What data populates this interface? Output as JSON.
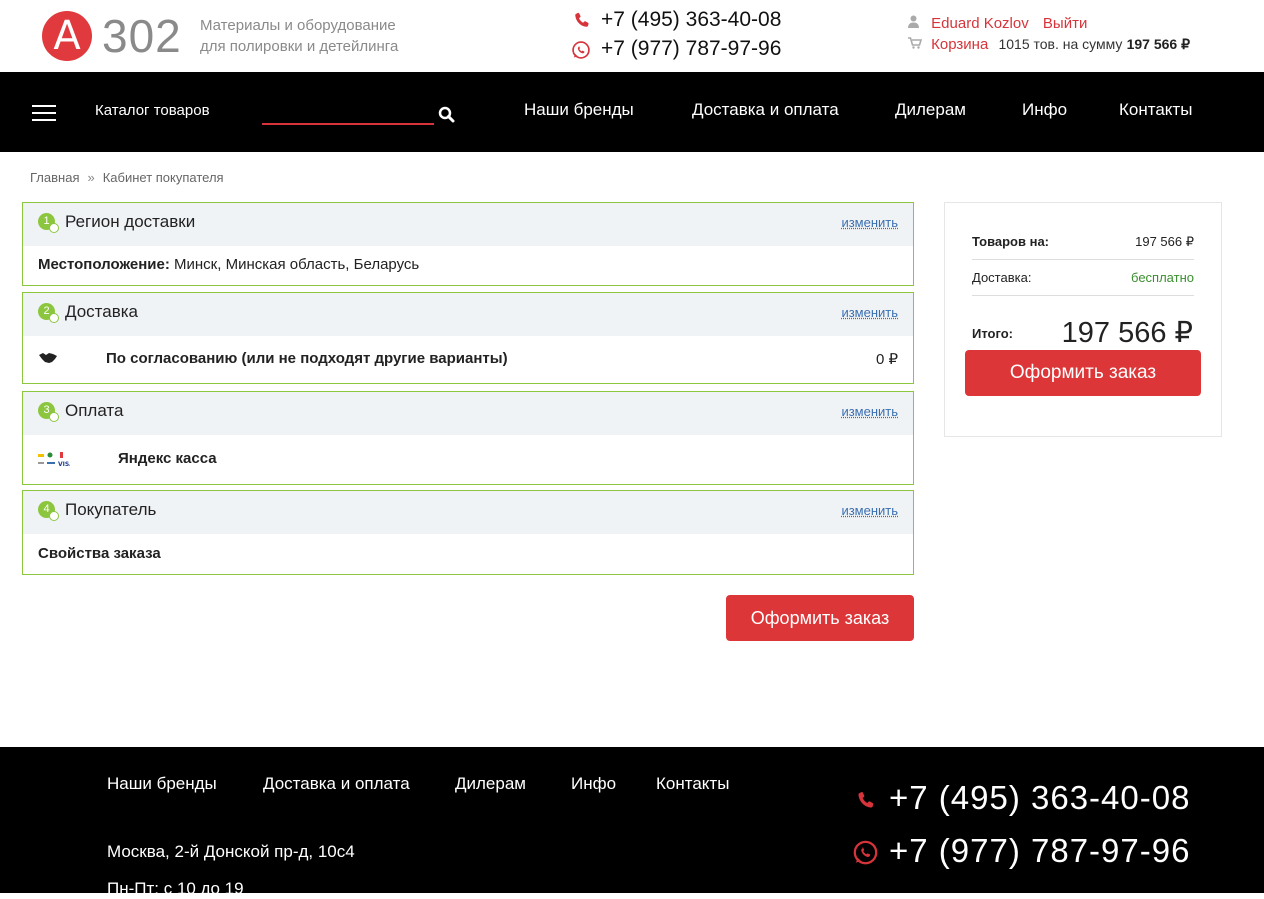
{
  "header": {
    "logo_letter": "A",
    "logo_number": "302",
    "tagline_1": "Материалы и оборудование",
    "tagline_2": "для полировки и детейлинга",
    "phone_1": "+7 (495) 363-40-08",
    "phone_2": "+7 (977) 787-97-96",
    "user_name": "Eduard Kozlov",
    "logout": "Выйти",
    "cart_label": "Корзина",
    "cart_summary": "1015 тов. на сумму",
    "cart_total": "197 566 ₽"
  },
  "nav": {
    "catalog": "Каталог товаров",
    "items": [
      "Наши бренды",
      "Доставка и оплата",
      "Дилерам",
      "Инфо",
      "Контакты"
    ]
  },
  "breadcrumb": [
    "Главная",
    "Кабинет покупателя"
  ],
  "blocks": {
    "region": {
      "num": "1",
      "title": "Регион доставки",
      "change": "изменить",
      "label": "Местоположение:",
      "value": "Минск, Минская область, Беларусь"
    },
    "delivery": {
      "num": "2",
      "title": "Доставка",
      "change": "изменить",
      "option": "По согласованию (или не подходят другие варианты)",
      "price": "0 ₽"
    },
    "payment": {
      "num": "3",
      "title": "Оплата",
      "change": "изменить",
      "option": "Яндекс касса"
    },
    "buyer": {
      "num": "4",
      "title": "Покупатель",
      "change": "изменить",
      "props": "Свойства заказа"
    }
  },
  "order_button": "Оформить заказ",
  "summary": {
    "goods_label": "Товаров на:",
    "goods_value": "197 566 ₽",
    "delivery_label": "Доставка:",
    "delivery_value": "бесплатно",
    "total_label": "Итого:",
    "total_value": "197 566 ₽",
    "button": "Оформить заказ"
  },
  "footer": {
    "nav": [
      "Наши бренды",
      "Доставка и оплата",
      "Дилерам",
      "Инфо",
      "Контакты"
    ],
    "address": "Москва, 2-й Донской пр-д, 10с4",
    "hours": "Пн-Пт: с 10 до 19",
    "phone_1": "+7 (495) 363-40-08",
    "phone_2": "+7 (977) 787-97-96"
  },
  "colors": {
    "accent": "#dd3638",
    "green": "#8cc63f",
    "link": "#3a6fb0"
  }
}
